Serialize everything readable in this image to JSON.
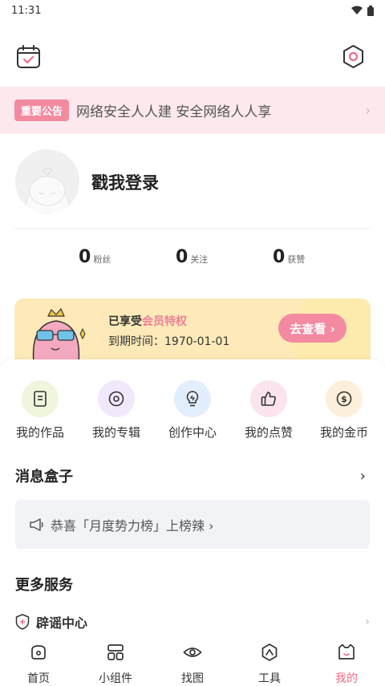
{
  "status_bar": {
    "time": "11:31"
  },
  "notice": {
    "tag": "重要公告",
    "text": "网络安全人人建 安全网络人人享",
    "arrow": "›"
  },
  "profile": {
    "login_text": "戳我登录"
  },
  "stats": [
    {
      "value": "0",
      "label": "粉丝"
    },
    {
      "value": "0",
      "label": "关注"
    },
    {
      "value": "0",
      "label": "获赞"
    }
  ],
  "vip": {
    "line1_prefix": "已享受",
    "line1_highlight": "会员特权",
    "line2": "到期时间：1970-01-01",
    "button": "去查看 ›"
  },
  "grid": [
    {
      "label": "我的作品",
      "icon": "works-icon",
      "bg": "#eff6dc"
    },
    {
      "label": "我的专辑",
      "icon": "album-icon",
      "bg": "#f2e8fb"
    },
    {
      "label": "创作中心",
      "icon": "creation-bulb-icon",
      "bg": "#e2eefc"
    },
    {
      "label": "我的点赞",
      "icon": "thumbs-up-icon",
      "bg": "#fbe4ef"
    },
    {
      "label": "我的金币",
      "icon": "coin-icon",
      "bg": "#fdf0da"
    }
  ],
  "message_box": {
    "title": "消息盒子",
    "arrow": "›",
    "item": "恭喜「月度势力榜」上榜辣 ›"
  },
  "more_services": {
    "title": "更多服务",
    "rumor_center": "辟谣中心",
    "arrow": "›"
  },
  "tabs": [
    {
      "label": "首页",
      "icon": "home-icon",
      "active": false
    },
    {
      "label": "小组件",
      "icon": "widgets-icon",
      "active": false
    },
    {
      "label": "找图",
      "icon": "eye-icon",
      "active": false
    },
    {
      "label": "工具",
      "icon": "tools-icon",
      "active": false
    },
    {
      "label": "我的",
      "icon": "profile-cat-icon",
      "active": true
    }
  ],
  "colors": {
    "accent": "#f06d8c",
    "notice_bg": "#fde9ed",
    "vip_bg": "#fdeab8"
  }
}
